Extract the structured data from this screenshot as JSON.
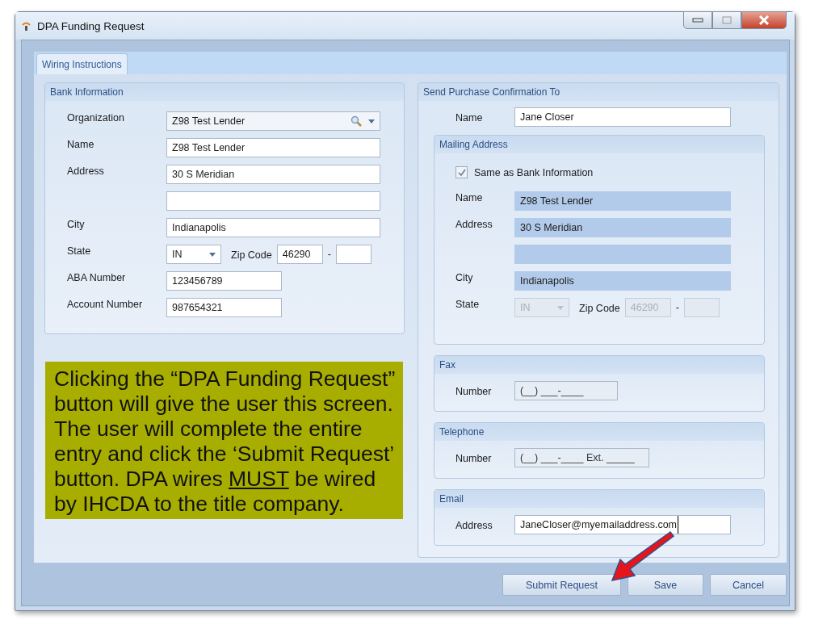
{
  "window": {
    "title": "DPA Funding Request"
  },
  "tabs": [
    {
      "label": "Wiring Instructions",
      "selected": true
    }
  ],
  "bank_information": {
    "title": "Bank Information",
    "fields": [
      {
        "kind": "lookup",
        "label": "Organization",
        "value": "Z98 Test Lender"
      },
      {
        "kind": "text",
        "label": "Name",
        "value": "Z98 Test Lender"
      },
      {
        "kind": "text",
        "label": "Address",
        "value": "30 S Meridian"
      },
      {
        "kind": "text"
      },
      {
        "kind": "text",
        "label": "City",
        "value": "Indianapolis"
      },
      {
        "kind": "state_zip",
        "label": "State",
        "state": "IN",
        "zip_label": "Zip Code",
        "zip": "46290",
        "separator": "-",
        "disabled": false
      },
      {
        "kind": "short",
        "label": "ABA Number",
        "value": "123456789"
      },
      {
        "kind": "short",
        "label": "Account Number",
        "value": "987654321"
      }
    ]
  },
  "confirmation": {
    "title": "Send Purchase Confirmation To",
    "name_label": "Name",
    "name": "Jane Closer",
    "mailing_address": {
      "title": "Mailing Address",
      "same_as_bank": {
        "label": "Same as Bank Information",
        "checked": true
      },
      "fields": [
        {
          "kind": "text",
          "label": "Name",
          "value": "Z98 Test Lender",
          "disabled": true
        },
        {
          "kind": "text",
          "label": "Address",
          "value": "30 S Meridian",
          "disabled": true
        },
        {
          "kind": "text",
          "disabled": true
        },
        {
          "kind": "text",
          "label": "City",
          "value": "Indianapolis",
          "disabled": true
        },
        {
          "kind": "state_zip",
          "label": "State",
          "state": "IN",
          "zip_label": "Zip Code",
          "zip": "46290",
          "separator": "-",
          "disabled": true
        }
      ]
    },
    "fax": {
      "title": "Fax",
      "label": "Number",
      "placeholder": "(__) ___-____"
    },
    "telephone": {
      "title": "Telephone",
      "label": "Number",
      "placeholder": "(__) ___-____ Ext. _____"
    },
    "email": {
      "title": "Email",
      "label": "Address",
      "value": "JaneCloser@myemailaddress.com",
      "focused": true
    }
  },
  "buttons": [
    "Submit Request",
    "Save",
    "Cancel"
  ],
  "callout": {
    "text_before": "Clicking the “DPA Funding Request” button will give the user this screen. The user will complete the entire entry and click the ‘Submit Request’ button.  DPA wires ",
    "underlined": "MUST",
    "text_after": " be wired by IHCDA to the title company."
  }
}
